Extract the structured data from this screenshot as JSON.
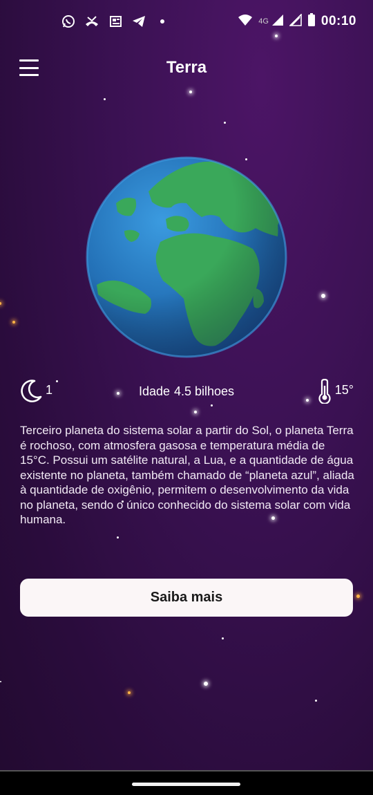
{
  "status_bar": {
    "network": "4G",
    "time": "00:10",
    "left_icons": [
      "whatsapp-icon",
      "missed-call-icon",
      "news-icon",
      "telegram-icon",
      "dot-icon"
    ]
  },
  "app_bar": {
    "title": "Terra"
  },
  "stats": {
    "moons": "1",
    "age_label": "Idade",
    "age_value": "4.5 bilhoes",
    "temperature": "15°"
  },
  "description": "Terceiro planeta do sistema solar a partir do Sol, o planeta Terra é rochoso, com atmosfera gasosa e temperatura média de 15°C. Possui um satélite natural, a Lua, e a quantidade de água existente no planeta, também chamado de “planeta azul”, aliada à quantidade de oxigênio, permitem o desenvolvimento da vida no planeta, sendo o único conhecido do sistema solar com vida humana.",
  "cta": {
    "label": "Saiba mais"
  },
  "colors": {
    "background": "#3a1152",
    "button_bg": "#fbf6f7",
    "ocean": "#2a7fc9",
    "land": "#3aa85a"
  }
}
